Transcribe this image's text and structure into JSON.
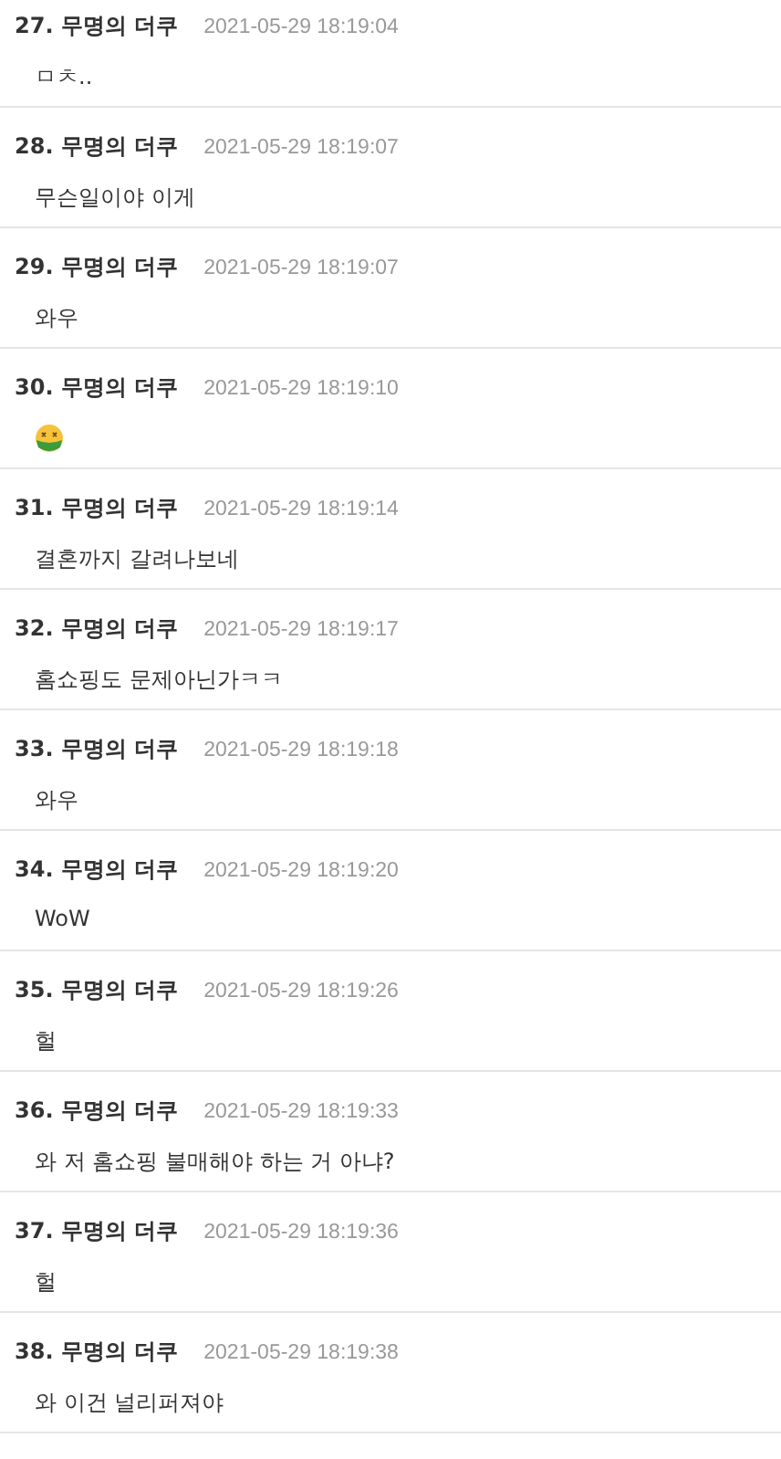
{
  "comments": [
    {
      "number": "27.",
      "author": "무명의 더쿠",
      "time": "2021-05-29 18:19:04",
      "kind": "text",
      "text": "ㅁㅊ.."
    },
    {
      "number": "28.",
      "author": "무명의 더쿠",
      "time": "2021-05-29 18:19:07",
      "kind": "text",
      "text": "무슨일이야 이게"
    },
    {
      "number": "29.",
      "author": "무명의 더쿠",
      "time": "2021-05-29 18:19:07",
      "kind": "text",
      "text": "와우"
    },
    {
      "number": "30.",
      "author": "무명의 더쿠",
      "time": "2021-05-29 18:19:10",
      "kind": "emoji"
    },
    {
      "number": "31.",
      "author": "무명의 더쿠",
      "time": "2021-05-29 18:19:14",
      "kind": "text",
      "text": "결혼까지 갈려나보네"
    },
    {
      "number": "32.",
      "author": "무명의 더쿠",
      "time": "2021-05-29 18:19:17",
      "kind": "text",
      "text": "홈쇼핑도 문제아닌가ㅋㅋ"
    },
    {
      "number": "33.",
      "author": "무명의 더쿠",
      "time": "2021-05-29 18:19:18",
      "kind": "text",
      "text": "와우"
    },
    {
      "number": "34.",
      "author": "무명의 더쿠",
      "time": "2021-05-29 18:19:20",
      "kind": "text",
      "text": "WoW"
    },
    {
      "number": "35.",
      "author": "무명의 더쿠",
      "time": "2021-05-29 18:19:26",
      "kind": "text",
      "text": "헐"
    },
    {
      "number": "36.",
      "author": "무명의 더쿠",
      "time": "2021-05-29 18:19:33",
      "kind": "text",
      "text": "와 저 홈쇼핑 불매해야 하는 거 아냐?"
    },
    {
      "number": "37.",
      "author": "무명의 더쿠",
      "time": "2021-05-29 18:19:36",
      "kind": "text",
      "text": "헐"
    },
    {
      "number": "38.",
      "author": "무명의 더쿠",
      "time": "2021-05-29 18:19:38",
      "kind": "text",
      "text": "와 이건 널리퍼져야"
    }
  ]
}
